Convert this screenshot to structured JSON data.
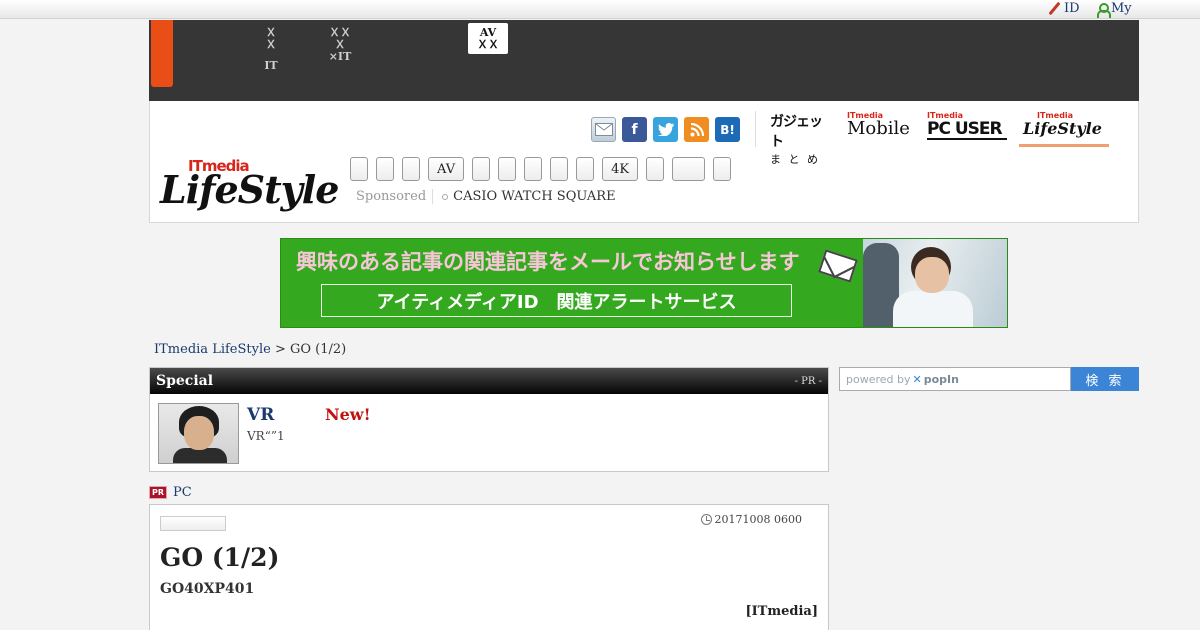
{
  "topbar": {
    "id_label": "ID",
    "my_label": "My"
  },
  "nav": {
    "items": [
      {
        "line1": "ＸＸ",
        "line2": "IT"
      },
      {
        "line1": "ＸＸＸ",
        "line2": "×IT"
      }
    ],
    "active": {
      "line1": "AV",
      "line2": "ＸＸ"
    }
  },
  "social": {
    "icons": [
      "mail-icon",
      "facebook-icon",
      "twitter-icon",
      "rss-icon",
      "hatena-bookmark-icon"
    ],
    "hatena_label": "B!"
  },
  "sites": {
    "gadget": {
      "line1": "ガジェット",
      "line2": "ま と め"
    },
    "mobile": {
      "top": "ITmedia",
      "name": "Mobile"
    },
    "pcuser": {
      "top": "ITmedia",
      "name": "PC USER"
    },
    "lifestyle": {
      "top": "ITmedia",
      "name": "LifeStyle"
    },
    "active_color": "#f0a070"
  },
  "logo": {
    "it": "ITmedia",
    "name": "LifeStyle"
  },
  "header_nav": {
    "buttons": [
      "",
      "",
      "",
      "AV",
      "",
      "",
      "",
      "",
      "",
      "4K",
      "",
      "",
      ""
    ]
  },
  "sponsored": {
    "label": "Sponsored",
    "link": "CASIO WATCH SQUARE"
  },
  "banner": {
    "headline": "興味のある記事の関連記事をメールでお知らせします",
    "service": "アイティメディアID　関連アラートサービス",
    "bg_color": "#34a81e"
  },
  "breadcrumb": {
    "home": "ITmedia LifeStyle",
    "separator": " > ",
    "current": "GO (1/2)"
  },
  "special": {
    "heading": "Special",
    "pr": "- PR -",
    "item": {
      "title": "VR",
      "badge": "New!",
      "desc": "VR“”1"
    }
  },
  "pr_link": {
    "badge": "PR",
    "text": "PC"
  },
  "article": {
    "date": "20171008 0600",
    "title": "GO (1/2)",
    "subtitle": "GO40XP401",
    "source": "[ITmedia]"
  },
  "search": {
    "powered_by": "powered by",
    "brand": "popIn",
    "button": "検 索"
  }
}
